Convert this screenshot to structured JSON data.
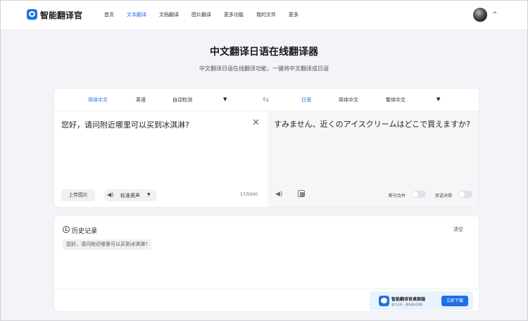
{
  "header": {
    "brand": "智能翻译官",
    "nav": [
      "首页",
      "文本翻译",
      "文档翻译",
      "图片翻译",
      "更多功能",
      "我的文件",
      "更多"
    ],
    "active_nav": "文本翻译"
  },
  "hero": {
    "title": "中文翻译日语在线翻译器",
    "subtitle": "中文翻译日语在线翻译功能，一键将中文翻译成日语"
  },
  "source_langs": [
    "简体中文",
    "英语",
    "自动检测"
  ],
  "target_langs": [
    "日语",
    "简体中文",
    "繁体中文"
  ],
  "source_text": "您好，请问附近哪里可以买到冰淇淋?",
  "target_text": "すみません、近くのアイスクリームはどこで買えますか?",
  "upload_label": "上传图片",
  "voice_label": "标准男声",
  "char_counter": "17/5000",
  "toggles": {
    "sentence_merge": "断句合并",
    "bilingual": "双语对照"
  },
  "history": {
    "title": "历史记录",
    "clear": "清空",
    "items": [
      "您好，请问附近哪里可以买到冰淇淋?"
    ]
  },
  "promo": {
    "title": "智能翻译官桌面端",
    "subtitle": "更大文件，更多格式转换",
    "button": "立即下载"
  },
  "colors": {
    "accent": "#1e6fe8",
    "background": "#f3f4f7"
  }
}
